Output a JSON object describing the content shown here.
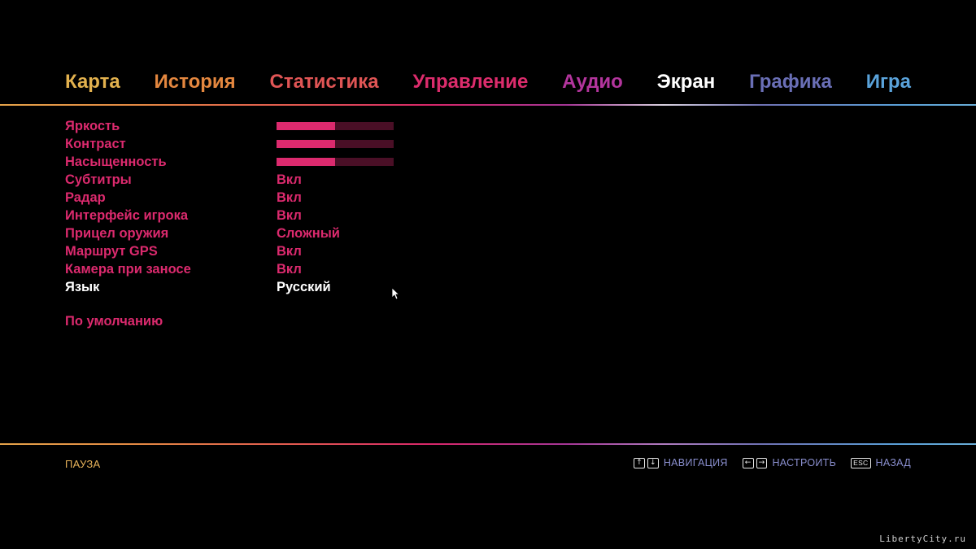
{
  "tabs": [
    {
      "label": "Карта",
      "color": "#e2b14e"
    },
    {
      "label": "История",
      "color": "#e4873f"
    },
    {
      "label": "Статистика",
      "color": "#e05555"
    },
    {
      "label": "Управление",
      "color": "#dc2c6c"
    },
    {
      "label": "Аудио",
      "color": "#b3359d"
    },
    {
      "label": "Экран",
      "color": "#ffffff",
      "active": true
    },
    {
      "label": "Графика",
      "color": "#6a6fb6"
    },
    {
      "label": "Игра",
      "color": "#5aa3db"
    }
  ],
  "settings": {
    "rows": [
      {
        "label": "Яркость",
        "type": "slider",
        "level": 0.5
      },
      {
        "label": "Контраст",
        "type": "slider",
        "level": 0.5
      },
      {
        "label": "Насыщенность",
        "type": "slider",
        "level": 0.5
      },
      {
        "label": "Субтитры",
        "type": "option",
        "value": "Вкл"
      },
      {
        "label": "Радар",
        "type": "option",
        "value": "Вкл"
      },
      {
        "label": "Интерфейс игрока",
        "type": "option",
        "value": "Вкл"
      },
      {
        "label": "Прицел оружия",
        "type": "option",
        "value": "Сложный"
      },
      {
        "label": "Маршрут GPS",
        "type": "option",
        "value": "Вкл"
      },
      {
        "label": "Камера при заносе",
        "type": "option",
        "value": "Вкл"
      },
      {
        "label": "Язык",
        "type": "option",
        "value": "Русский",
        "selected": true
      }
    ],
    "defaults_label": "По умолчанию"
  },
  "footer": {
    "pause_label": "ПАУЗА",
    "hints": [
      {
        "keys": [
          "↑",
          "↓"
        ],
        "label": "НАВИГАЦИЯ"
      },
      {
        "keys": [
          "←",
          "→"
        ],
        "label": "НАСТРОИТЬ"
      },
      {
        "keys": [
          "ESC"
        ],
        "label": "НАЗАД"
      }
    ]
  },
  "watermark": "LibertyCity.ru",
  "colors": {
    "accent": "#dc2a6e",
    "slider_track": "#4a0f26",
    "selected": "#ffffff",
    "pause": "#e8b35a",
    "hint": "#8a8fcf"
  }
}
